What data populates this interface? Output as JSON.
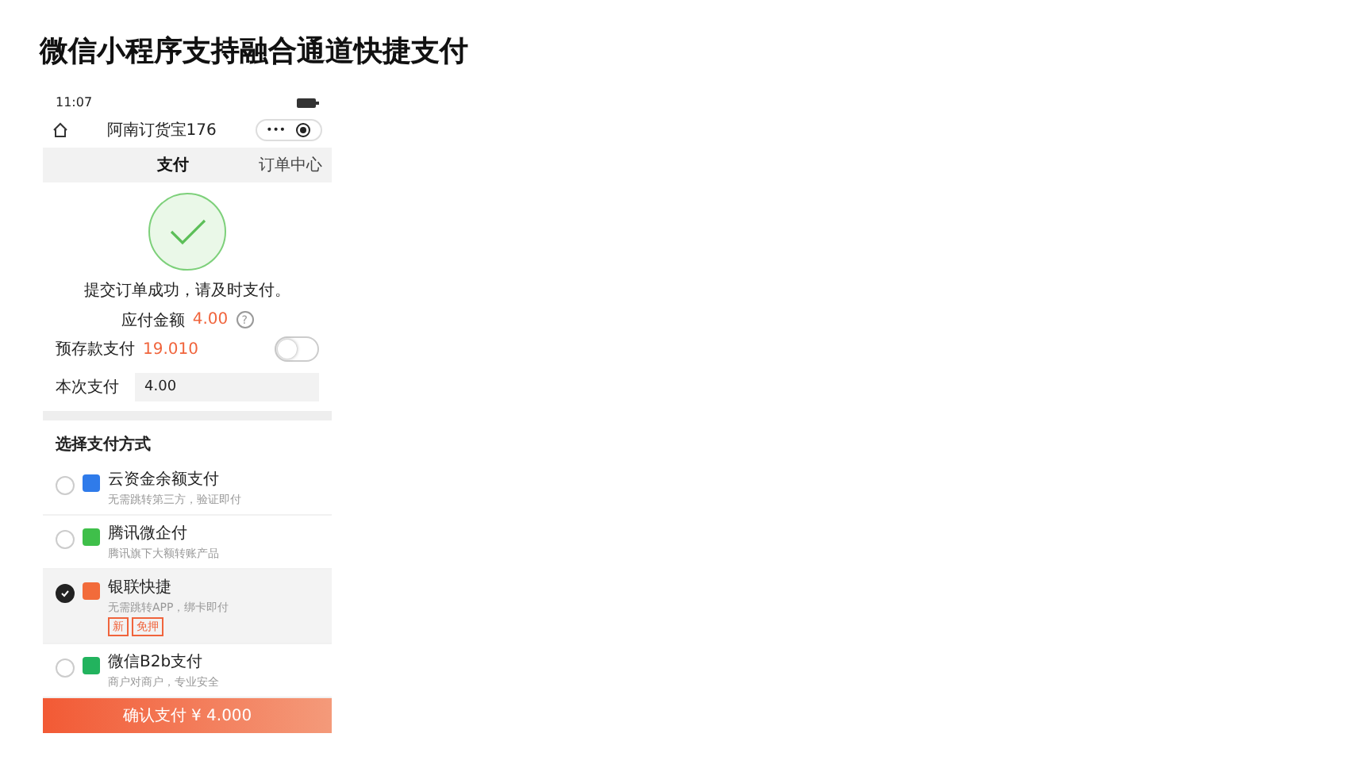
{
  "slide_title": "微信小程序支持融合通道快捷支付",
  "phone": {
    "status_bar": {
      "time": "11:07"
    },
    "nav": {
      "title": "阿南订货宝176",
      "more": "•••"
    },
    "tabs": [
      {
        "label": "支付",
        "selected": true
      },
      {
        "label": "订单中心",
        "selected": false
      }
    ],
    "success": {
      "message": "提交订单成功，请及时支付。",
      "amount_label": "应付金额",
      "amount": "4.00",
      "help": "?"
    },
    "prepaid": {
      "label": "预存款支付",
      "balance": "19.010",
      "on": false
    },
    "this_payment": {
      "label": "本次支付",
      "value": "4.00"
    },
    "methods_title": "选择支付方式",
    "methods": [
      {
        "name": "云资金余额支付",
        "desc": "无需跳转第三方，验证即付",
        "color": "#2f7bea",
        "selected": false
      },
      {
        "name": "腾讯微企付",
        "desc": "腾讯旗下大额转账产品",
        "color": "#3fbf4a",
        "selected": false
      },
      {
        "name": "银联快捷",
        "desc": "无需跳转APP，绑卡即付",
        "color": "#f26b3a",
        "selected": true,
        "tags": [
          "新",
          "免押"
        ]
      },
      {
        "name": "微信B2b支付",
        "desc": "商户对商户，专业安全",
        "color": "#22b35e",
        "selected": false
      }
    ],
    "confirm": "确认支付 ¥ 4.000"
  }
}
